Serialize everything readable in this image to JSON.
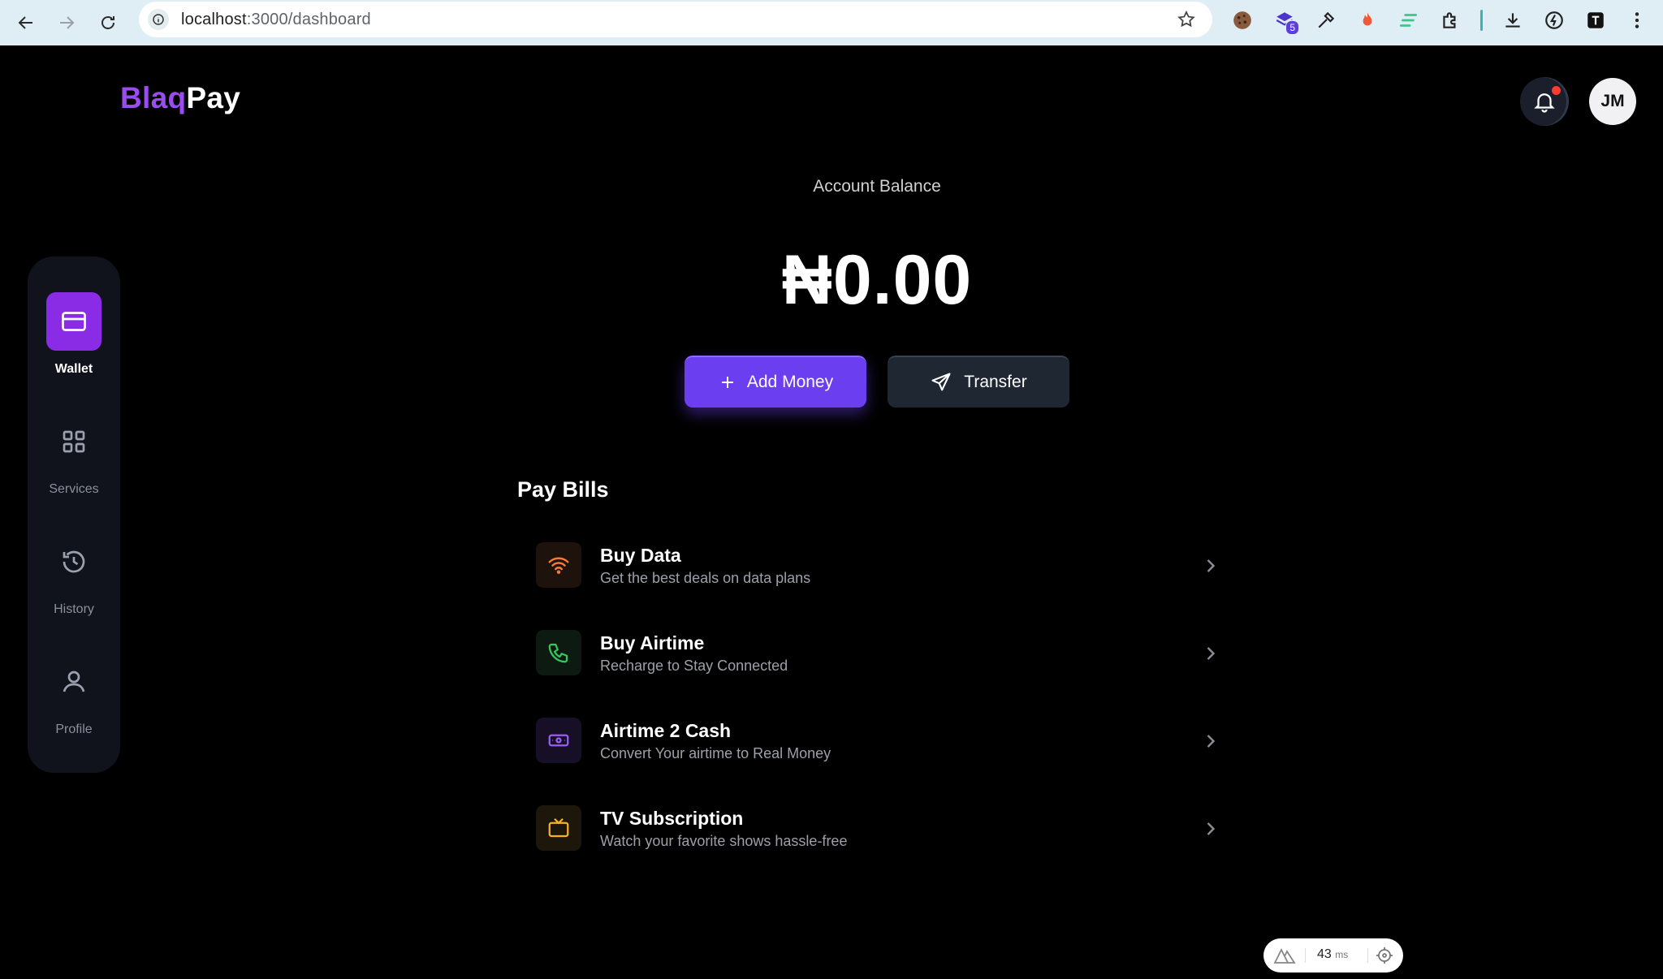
{
  "browser": {
    "url_host": "localhost",
    "url_path": ":3000/dashboard",
    "extension_badge": "5"
  },
  "header": {
    "logo_part1": "Blaq",
    "logo_part2": "Pay",
    "avatar_initials": "JM"
  },
  "sidebar": {
    "items": [
      {
        "label": "Wallet",
        "icon": "card-icon",
        "active": true
      },
      {
        "label": "Services",
        "icon": "grid-icon",
        "active": false
      },
      {
        "label": "History",
        "icon": "history-icon",
        "active": false
      },
      {
        "label": "Profile",
        "icon": "user-icon",
        "active": false
      }
    ]
  },
  "balance": {
    "label": "Account Balance",
    "amount": "₦0.00",
    "add_money_label": "Add Money",
    "transfer_label": "Transfer"
  },
  "pay_bills": {
    "title": "Pay Bills",
    "items": [
      {
        "title": "Buy Data",
        "subtitle": "Get the best deals on data plans",
        "icon": "wifi-icon",
        "color": "#f07a3a"
      },
      {
        "title": "Buy Airtime",
        "subtitle": "Recharge to Stay Connected",
        "icon": "phone-icon",
        "color": "#34c759"
      },
      {
        "title": "Airtime 2 Cash",
        "subtitle": "Convert Your airtime to Real Money",
        "icon": "cash-icon",
        "color": "#9b5cf6"
      },
      {
        "title": "TV Subscription",
        "subtitle": "Watch your favorite shows hassle-free",
        "icon": "tv-icon",
        "color": "#f5b324"
      }
    ]
  },
  "dev_indicator": {
    "value": "43",
    "unit": "ms"
  },
  "colors": {
    "accent": "#6b3ef0",
    "logo_purple": "#9a4cf0",
    "sidebar_active": "#8a2be6",
    "background": "#000000"
  }
}
